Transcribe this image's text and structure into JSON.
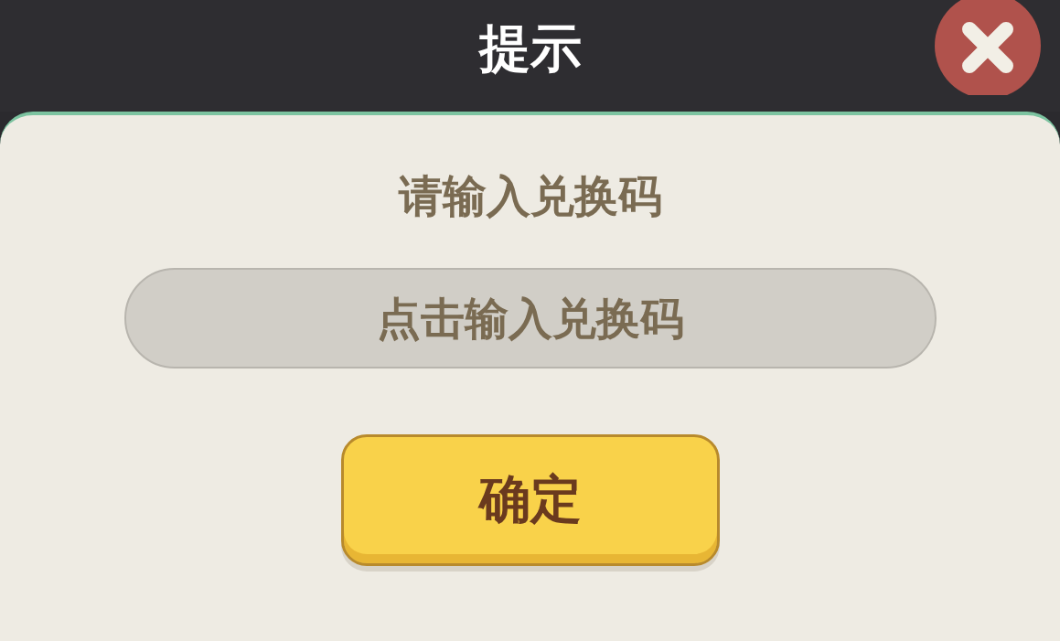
{
  "dialog": {
    "title": "提示",
    "prompt": "请输入兑换码",
    "code_field": {
      "placeholder": "点击输入兑换码"
    },
    "confirm_button": "确定"
  }
}
